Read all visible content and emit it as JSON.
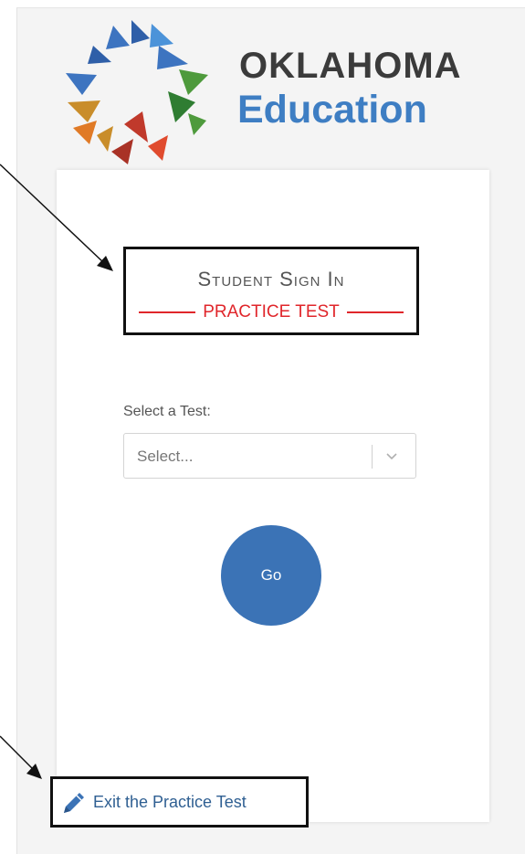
{
  "brand": {
    "line1": "OKLAHOMA",
    "line2": "Education",
    "colors": {
      "blue_dark": "#2f5fa8",
      "blue_light": "#4c93d9",
      "green": "#4e9a3c",
      "orange": "#e07a26",
      "red": "#c0392b",
      "gold": "#c98d2a",
      "text_dark": "#3b3b3b",
      "text_blue": "#3e7ec3"
    }
  },
  "signin": {
    "title": "Student Sign In",
    "subtitle": "PRACTICE TEST"
  },
  "test_select": {
    "label": "Select a Test:",
    "value": "Select...",
    "icon": "chevron-down-icon"
  },
  "go_button": {
    "label": "Go",
    "color": "#3b73b6"
  },
  "exit_link": {
    "label": "Exit the Practice Test",
    "icon": "pencil-icon"
  },
  "annotations": {
    "arrow_color": "#111111",
    "highlight_border": "#111111"
  }
}
